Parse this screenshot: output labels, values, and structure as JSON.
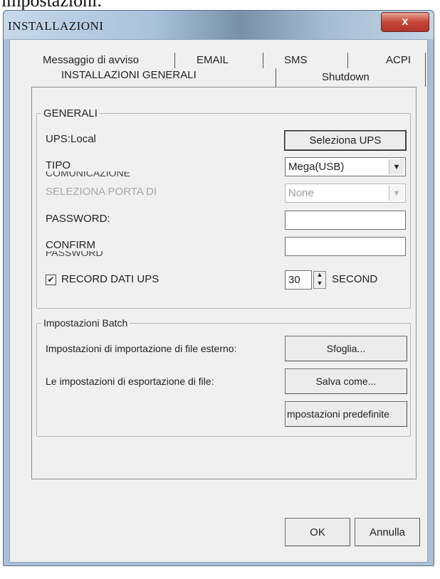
{
  "top_text": "impostazioni.",
  "window": {
    "title": "INSTALLAZIONI",
    "close_glyph": "x"
  },
  "tabs": {
    "row1": [
      "Messaggio di avviso",
      "EMAIL",
      "SMS",
      "ACPI"
    ],
    "row2": [
      "INSTALLAZIONI GENERALI",
      "Shutdown"
    ],
    "active": "INSTALLAZIONI GENERALI"
  },
  "general": {
    "title": "GENERALI",
    "ups_label": "UPS:Local",
    "select_ups_button": "Seleziona UPS",
    "type_label": "TIPO",
    "type_overflow": "COMUNICAZIONE",
    "type_value": "Mega(USB)",
    "port_label": "SELEZIONA PORTA DI",
    "port_value": "None",
    "password_label": "PASSWORD:",
    "password_value": "",
    "confirm_label": "CONFIRM",
    "confirm_overflow": "PASSWORD",
    "confirm_value": "",
    "record_checked": true,
    "record_label": "RECORD DATI UPS",
    "interval_value": "30",
    "interval_unit": "SECOND"
  },
  "batch": {
    "title": "Impostazioni Batch",
    "import_label": "Impostazioni di importazione di file esterno:",
    "import_button": "Sfoglia...",
    "export_label": "Le impostazioni di esportazione di file:",
    "export_button": "Salva come...",
    "defaults_button": "mpostazioni predefinite"
  },
  "footer": {
    "ok_button": "OK",
    "cancel_button": "Annulla"
  }
}
